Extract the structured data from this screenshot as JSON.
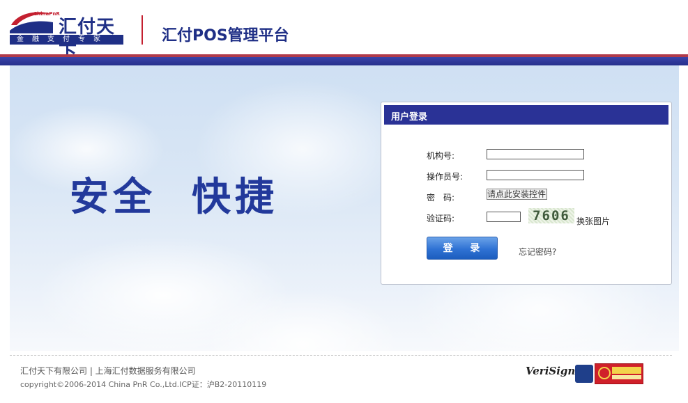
{
  "header": {
    "logo_brand": "汇付天下",
    "logo_small": "ChinaPnR",
    "logo_tagline": "金融支付专家",
    "platform_title": "汇付POS管理平台"
  },
  "banner": {
    "slogan": "安全  快捷"
  },
  "login": {
    "title": "用户登录",
    "institution_label": "机构号:",
    "institution_value": "",
    "operator_label": "操作员号:",
    "operator_value": "",
    "password_label": "密　码:",
    "password_control_text": "请点此安装控件",
    "captcha_label": "验证码:",
    "captcha_value": "",
    "captcha_image_text": "7606",
    "refresh_captcha": "换张图片",
    "login_button": "登 录",
    "forgot_password": "忘记密码?"
  },
  "footer": {
    "companies": "汇付天下有限公司 | 上海汇付数据服务有限公司",
    "copyright": "copyright©2006-2014 China PnR Co.,Ltd.ICP证：沪B2-20110119",
    "verisign": "VeriSign"
  },
  "colors": {
    "brand_blue": "#1f2f86",
    "brand_red": "#c42030",
    "login_header": "#2a3296",
    "button_blue": "#2f72d4"
  }
}
